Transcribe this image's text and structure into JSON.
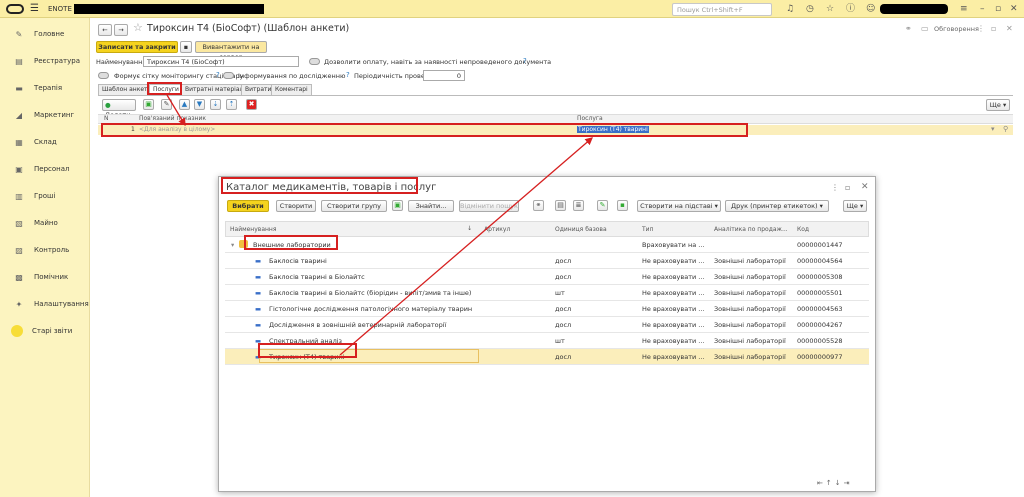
{
  "app": {
    "name": "ENOTE",
    "search_placeholder": "Пошук Ctrl+Shift+F"
  },
  "sidebar": {
    "items": [
      {
        "label": "Головне",
        "icon": "star-icon"
      },
      {
        "label": "Реєстратура",
        "icon": "book-icon"
      },
      {
        "label": "Терапія",
        "icon": "folder-icon"
      },
      {
        "label": "Маркетинг",
        "icon": "megaphone-icon"
      },
      {
        "label": "Склад",
        "icon": "box-icon"
      },
      {
        "label": "Персонал",
        "icon": "person-icon"
      },
      {
        "label": "Гроші",
        "icon": "money-icon"
      },
      {
        "label": "Майно",
        "icon": "building-icon"
      },
      {
        "label": "Контроль",
        "icon": "chart-icon"
      },
      {
        "label": "Помічник",
        "icon": "assistant-icon"
      },
      {
        "label": "Налаштування",
        "icon": "wrench-icon"
      },
      {
        "label": "Старі звіти",
        "icon": "yellow-circle-icon"
      }
    ]
  },
  "form": {
    "title": "Тироксин Т4 (БіоСофт) (Шаблон анкети)",
    "discussions": "Обговорення",
    "save_close": "Записати та закрити",
    "unload": "Вивантажити на сервер",
    "name_label": "Найменування:",
    "name_value": "Тироксин Т4 (БіоСофт)",
    "allow_payment": "Дозволити оплату, навіть за наявності непроведеного документа",
    "monitoring": "Формує сітку моніторингу стаціонару",
    "inform": "Інформування по дослідженню",
    "periodicity_label": "Періодичність проведення, дні:",
    "periodicity_value": "0",
    "tabs": [
      "Шаблон анкети",
      "Послуги",
      "Витратні матеріали",
      "Витрати",
      "Коментарі"
    ],
    "add_button": "Додати",
    "more": "Ще",
    "table_headers": [
      "N",
      "Пов'язаний показник",
      "Послуга"
    ],
    "row": {
      "n": "1",
      "indicator": "<Для аналізу в цілому>",
      "service": "Тироксин (Т4) тварині"
    }
  },
  "dialog": {
    "title": "Каталог медикаментів, товарів і послуг",
    "buttons": {
      "select": "Вибрати",
      "create": "Створити",
      "create_group": "Створити групу",
      "find": "Знайти...",
      "cancel_search": "Відмінити пошук",
      "create_based": "Створити на підставі",
      "print": "Друк (принтер етикеток)",
      "more": "Ще"
    },
    "headers": [
      "Найменування",
      "Артикул",
      "Одиниця базова",
      "Тип",
      "Аналітика по продаж...",
      "Код"
    ],
    "rows": [
      {
        "name": "Внешние лаборатории",
        "article": "",
        "unit": "",
        "type": "Враховувати на ...",
        "analytics": "",
        "code": "00000001447",
        "group": true
      },
      {
        "name": "Баклосів тварині",
        "article": "",
        "unit": "досл",
        "type": "Не враховувати ...",
        "analytics": "Зовнішні лабораторії",
        "code": "00000004564"
      },
      {
        "name": "Баклосів тварині в Біолайтс",
        "article": "",
        "unit": "досл",
        "type": "Не враховувати ...",
        "analytics": "Зовнішні лабораторії",
        "code": "00000005308"
      },
      {
        "name": "Баклосів тварині в Біолайтс (біорідин - випіт/змив та інше)",
        "article": "",
        "unit": "шт",
        "type": "Не враховувати ...",
        "analytics": "Зовнішні лабораторії",
        "code": "00000005501"
      },
      {
        "name": "Гістологічне дослідження патологічного матеріалу тварин",
        "article": "",
        "unit": "досл",
        "type": "Не враховувати ...",
        "analytics": "Зовнішні лабораторії",
        "code": "00000004563"
      },
      {
        "name": "Дослідження в зовнішній ветеринарній лабораторії",
        "article": "",
        "unit": "досл",
        "type": "Не враховувати ...",
        "analytics": "Зовнішні лабораторії",
        "code": "00000004267"
      },
      {
        "name": "Спектральний аналіз",
        "article": "",
        "unit": "шт",
        "type": "Не враховувати ...",
        "analytics": "Зовнішні лабораторії",
        "code": "00000005528"
      },
      {
        "name": "Тироксин (Т4) тварині",
        "article": "",
        "unit": "досл",
        "type": "Не враховувати ...",
        "analytics": "Зовнішні лабораторії",
        "code": "00000000977",
        "selected": true
      }
    ]
  },
  "colors": {
    "accent": "#f5d31e",
    "sidebar": "#fcf4c0",
    "highlight": "#d62020"
  }
}
